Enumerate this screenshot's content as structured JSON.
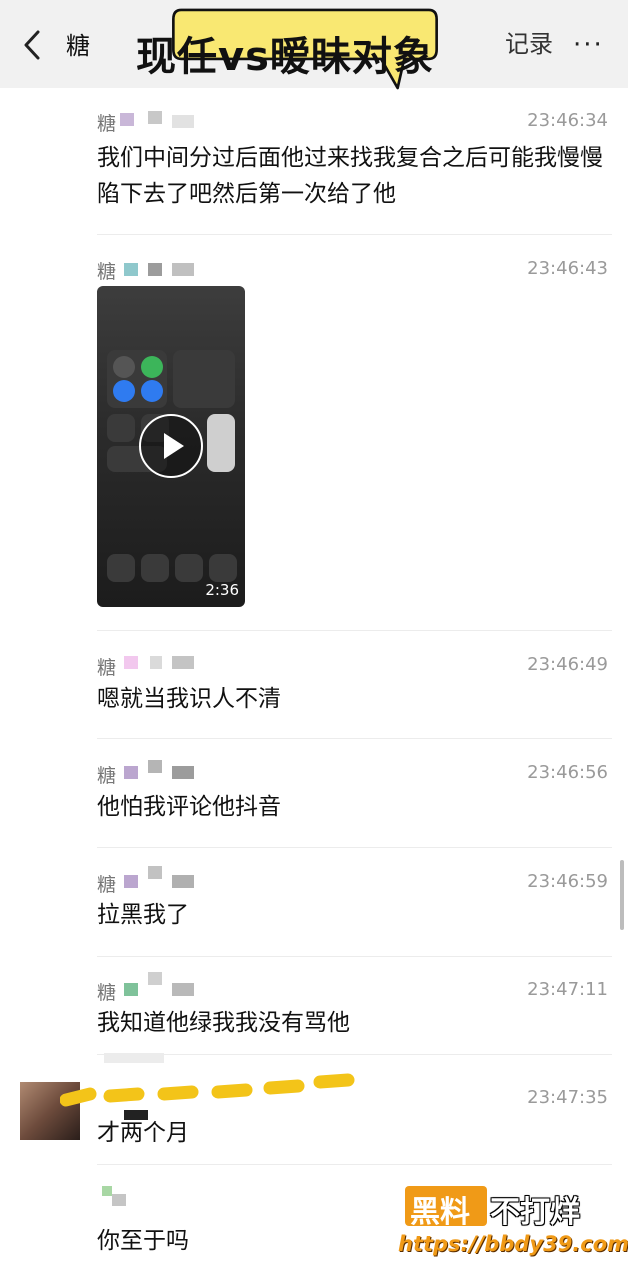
{
  "header": {
    "title_left": "糖",
    "title_right": "记录",
    "more_label": "···",
    "banner_caption": "现任vs暧昧对象"
  },
  "messages": [
    {
      "sender": "糖",
      "time": "23:46:34",
      "text": "我们中间分过后面他过来找我复合之后可能我慢慢陷下去了吧然后第一次给了他"
    },
    {
      "sender": "糖",
      "time": "23:46:43",
      "video_duration": "2:36"
    },
    {
      "sender": "糖",
      "time": "23:46:49",
      "text": "嗯就当我识人不清"
    },
    {
      "sender": "糖",
      "time": "23:46:56",
      "text": "他怕我评论他抖音"
    },
    {
      "sender": "糖",
      "time": "23:46:59",
      "text": "拉黑我了"
    },
    {
      "sender": "糖",
      "time": "23:47:11",
      "text": "我知道他绿我我没有骂他"
    },
    {
      "sender": "",
      "time": "23:47:35",
      "text": "才两个月"
    },
    {
      "sender": "",
      "time": "",
      "text": "你至于吗"
    }
  ],
  "watermark": {
    "brand_a": "黑料",
    "brand_b": "不打烊",
    "url": "https://bbdy39.com"
  },
  "colors": {
    "topbar_bg": "#f1f1f1",
    "banner_fill": "#f9e872",
    "highlight": "#f3c419",
    "watermark_orange": "#f09a17"
  }
}
